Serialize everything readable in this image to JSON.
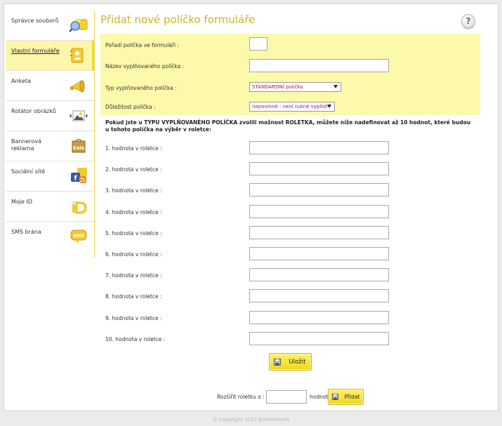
{
  "sidebar": {
    "items": [
      {
        "label": "Správce souborů",
        "icon": "file-manager-icon"
      },
      {
        "label": "Vlastní formuláře",
        "icon": "custom-forms-icon",
        "active": true
      },
      {
        "label": "Anketa",
        "icon": "poll-megaphone-icon"
      },
      {
        "label": "Rotátor obrázků",
        "icon": "image-rotator-icon"
      },
      {
        "label": "Bannerová reklama",
        "icon": "banner-sale-icon"
      },
      {
        "label": "Sociální sítě",
        "icon": "social-networks-icon"
      },
      {
        "label": "Moje ID",
        "icon": "moje-id-icon"
      },
      {
        "label": "SMS brána",
        "icon": "sms-gateway-icon"
      }
    ]
  },
  "header": {
    "title": "Přidat nové políčko formuláře",
    "help_glyph": "?"
  },
  "form": {
    "order_label": "Pořadí políčka ve formuláři  :",
    "order_value": "",
    "name_label": "Název vyplňovaného políčka  :",
    "name_value": "",
    "type_label": "Typ vyplňovaného políčka  :",
    "type_selected": "STANDARDNÍ políčko",
    "importance_label": "Důležitost políčka  :",
    "importance_selected": "nepovinné - není nutné vyplnit"
  },
  "note": "Pokud jste u TYPU VYPLŇOVANÉHO POLÍČKA zvolili možnost ROLETKA, můžete níže nadefinovat až 10 hodnot, které budou u tohoto políčka na výběr v roletce:",
  "options": [
    {
      "label": "1. hodnota v roletce  :",
      "value": ""
    },
    {
      "label": "2. hodnota v roletce  :",
      "value": ""
    },
    {
      "label": "3. hodnota v roletce  :",
      "value": ""
    },
    {
      "label": "4. hodnota v roletce  :",
      "value": ""
    },
    {
      "label": "5. hodnota v roletce  :",
      "value": ""
    },
    {
      "label": "6. hodnota v roletce  :",
      "value": ""
    },
    {
      "label": "7. hodnota v roletce  :",
      "value": ""
    },
    {
      "label": "8. hodnota v roletce  :",
      "value": ""
    },
    {
      "label": "9. hodnota v roletce  :",
      "value": ""
    },
    {
      "label": "10. hodnota v roletce  :",
      "value": ""
    }
  ],
  "buttons": {
    "save_label": "Uložit",
    "add_label": "Přidat"
  },
  "extend": {
    "prefix": "Rozšířit roletku o  :",
    "value": "",
    "suffix": "hodnot"
  },
  "footer": "© Copyright 2012 Bohemiasoft",
  "colors": {
    "accent": "#d2b324",
    "panel": "#fcf9ab",
    "button": "#f1d718"
  }
}
